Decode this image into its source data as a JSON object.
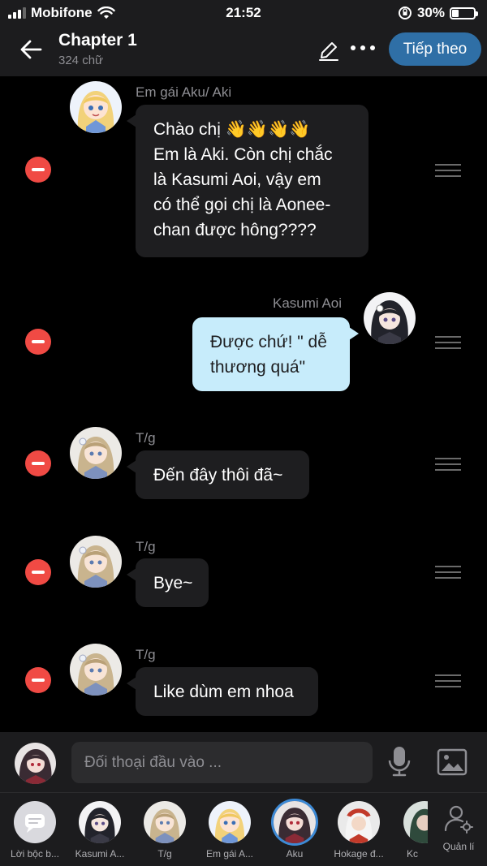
{
  "status_bar": {
    "carrier": "Mobifone",
    "time": "21:52",
    "battery": "30%"
  },
  "header": {
    "title": "Chapter 1",
    "subtitle": "324 chữ",
    "next_label": "Tiếp theo"
  },
  "messages": [
    {
      "speaker": "Em gái Aku/ Aki",
      "lines": [
        "Chào chị 👋👋👋👋",
        "Em là Aki. Còn chị chắc",
        "là Kasumi Aoi, vậy em",
        "có thể gọi chị là Aonee-",
        "chan được hông????"
      ]
    },
    {
      "speaker": "Kasumi Aoi",
      "lines": [
        "Được chứ! \" dễ",
        "thương quá\""
      ]
    },
    {
      "speaker": "T/g",
      "lines": [
        "Đến đây thôi đã~"
      ]
    },
    {
      "speaker": "T/g",
      "lines": [
        "Bye~"
      ]
    },
    {
      "speaker": "T/g",
      "lines": [
        "Like dùm em nhoa"
      ]
    }
  ],
  "input": {
    "placeholder": "Đối thoại đầu vào ..."
  },
  "characters": [
    {
      "name": "Lời bộc b..."
    },
    {
      "name": "Kasumi A..."
    },
    {
      "name": "T/g"
    },
    {
      "name": "Em gái A..."
    },
    {
      "name": "Aku"
    },
    {
      "name": "Hokage đ..."
    },
    {
      "name": "Kc"
    }
  ],
  "manage_label": "Quản lí",
  "colors": {
    "accent": "#2f6fa6",
    "remove": "#f04a44",
    "bubble_self": "#c7ecfb",
    "bubble_other": "#1e1e20"
  }
}
